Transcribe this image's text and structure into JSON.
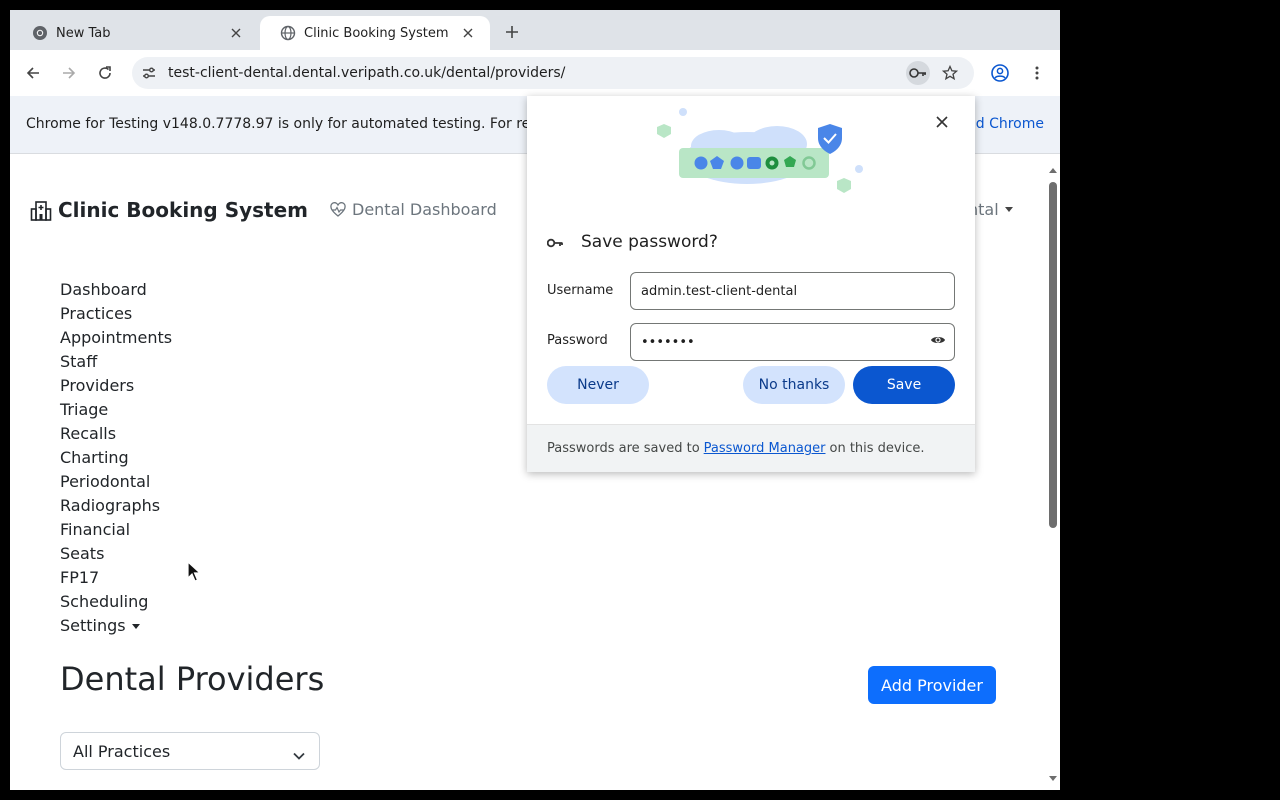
{
  "browser": {
    "tabs": [
      {
        "title": "New Tab"
      },
      {
        "title": "Clinic Booking System"
      }
    ],
    "url": "test-client-dental.dental.veripath.co.uk/dental/providers/",
    "infobar": {
      "text": "Chrome for Testing v148.0.7778.97 is only for automated testing. For re",
      "link": "d Chrome"
    }
  },
  "app": {
    "brand": "Clinic Booking System",
    "dashboard_link": "Dental Dashboard",
    "practice_dropdown": "ntal",
    "nav": [
      {
        "label": "Dashboard"
      },
      {
        "label": "Practices"
      },
      {
        "label": "Appointments"
      },
      {
        "label": "Staff"
      },
      {
        "label": "Providers"
      },
      {
        "label": "Triage"
      },
      {
        "label": "Recalls"
      },
      {
        "label": "Charting"
      },
      {
        "label": "Periodontal"
      },
      {
        "label": "Radiographs"
      },
      {
        "label": "Financial"
      },
      {
        "label": "Seats"
      },
      {
        "label": "FP17"
      },
      {
        "label": "Scheduling"
      },
      {
        "label": "Settings"
      }
    ],
    "page_title": "Dental Providers",
    "add_button": "Add Provider",
    "practice_filter": "All Practices"
  },
  "password_bubble": {
    "title": "Save password?",
    "username_label": "Username",
    "username_value": "admin.test-client-dental",
    "password_label": "Password",
    "password_value": "•••••••",
    "never": "Never",
    "no_thanks": "No thanks",
    "save": "Save",
    "footer_prefix": "Passwords are saved to",
    "footer_link": "Password Manager",
    "footer_suffix": "on this device."
  },
  "colors": {
    "primary": "#0d6efd",
    "chrome_blue": "#0b57d0",
    "tonal_blue": "#d3e3fd"
  },
  "icons": [
    "chrome-icon",
    "globe-icon",
    "close-icon",
    "plus-icon",
    "back-icon",
    "forward-icon",
    "reload-icon",
    "site-info-icon",
    "key-icon",
    "star-icon",
    "profile-icon",
    "menu-icon",
    "hospital-icon",
    "heart-pulse-icon",
    "chevron-down-icon",
    "eye-icon"
  ]
}
